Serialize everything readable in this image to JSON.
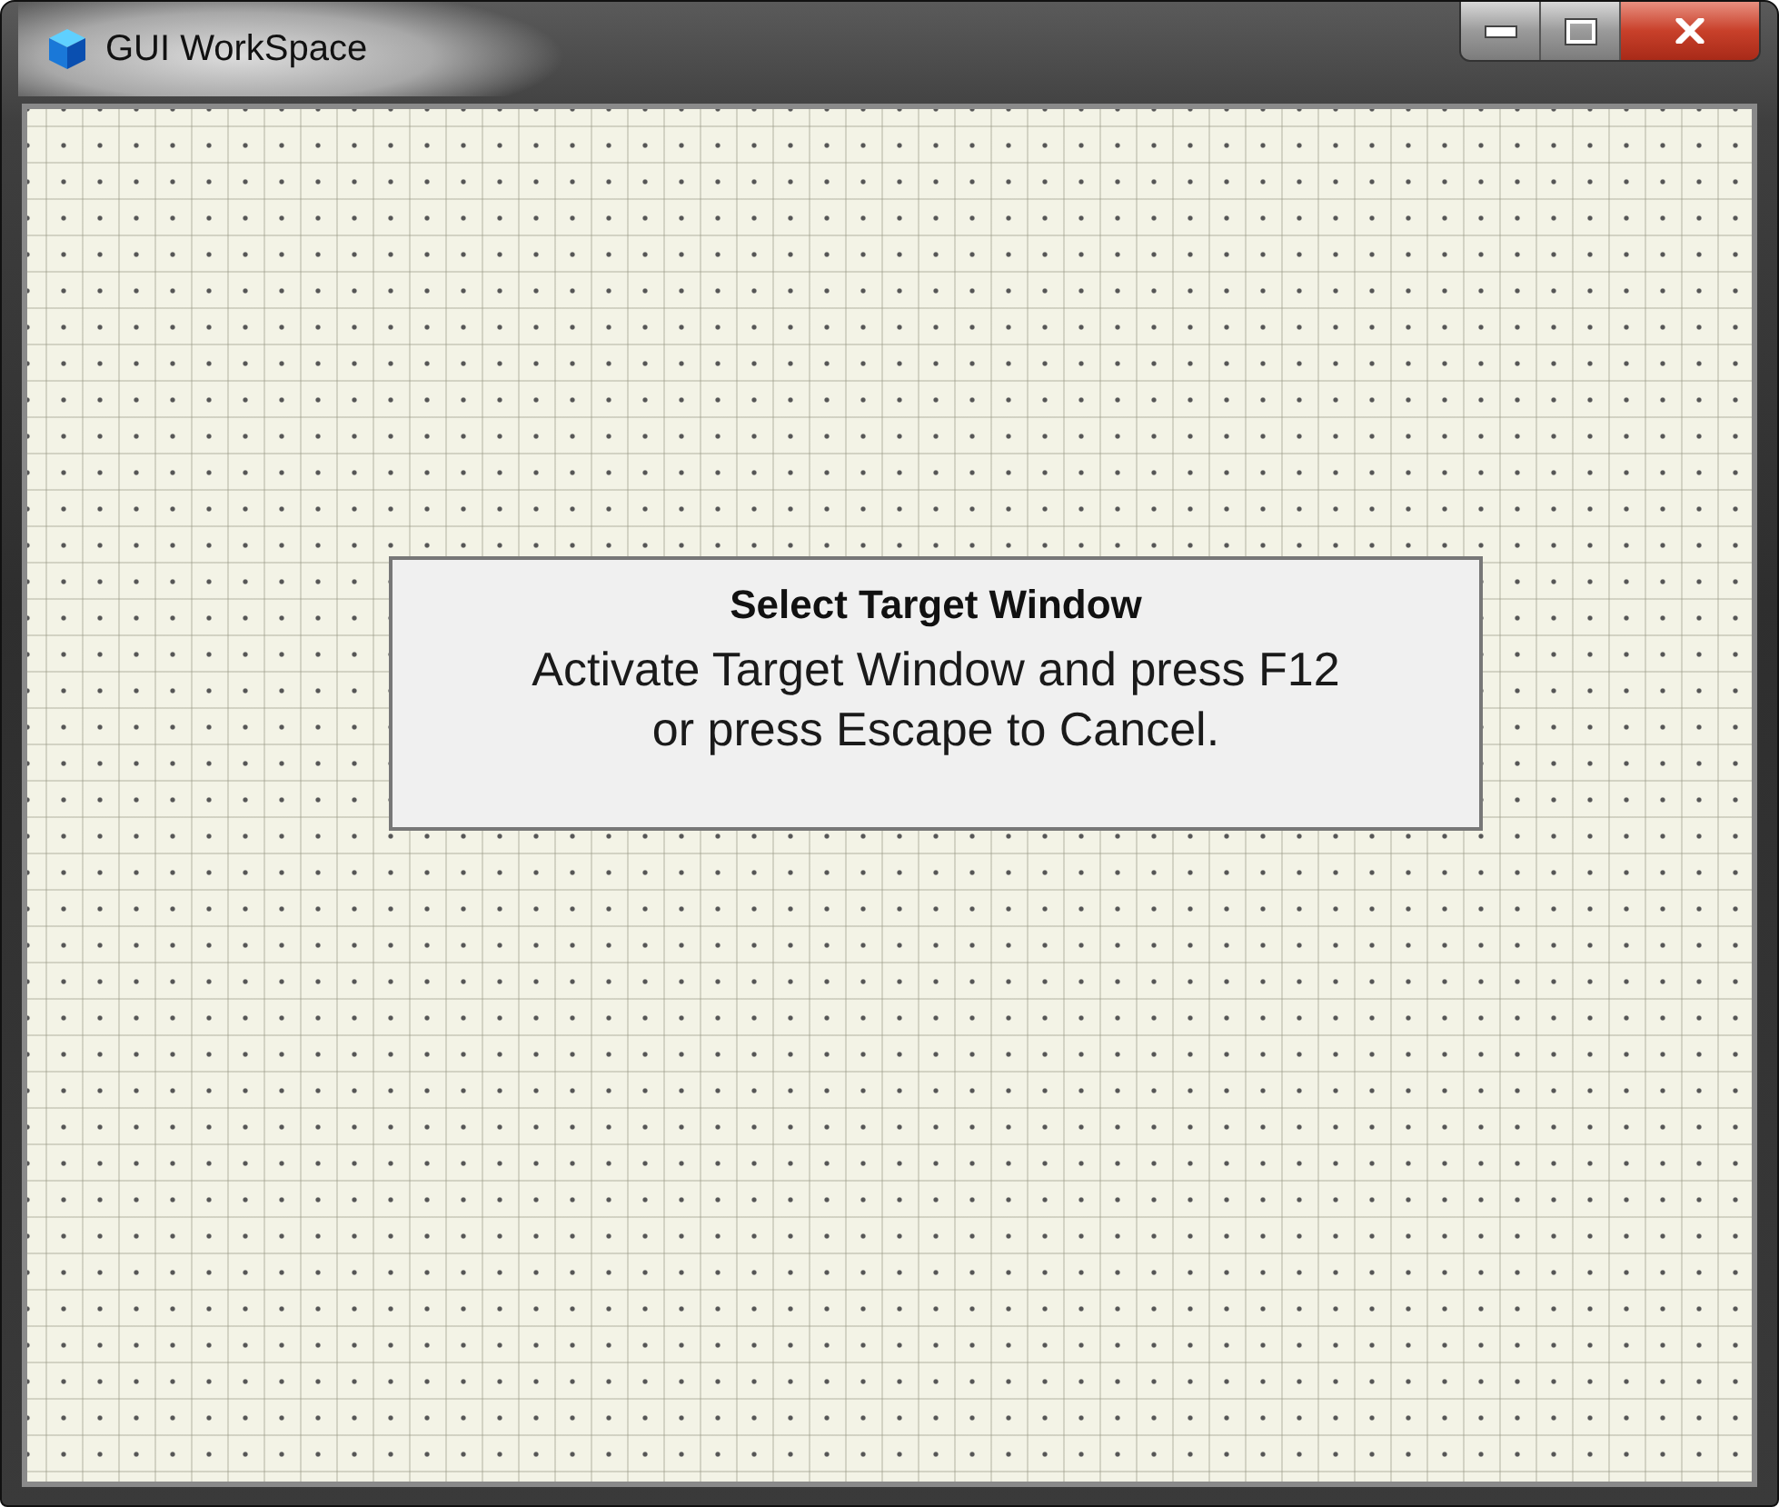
{
  "window": {
    "title": "GUI WorkSpace",
    "buttons": [
      {
        "kind": "minimize"
      },
      {
        "kind": "maximize"
      },
      {
        "kind": "close"
      }
    ]
  },
  "dialog": {
    "title": "Select Target Window",
    "message": "Activate Target Window and press F12\nor press Escape to Cancel."
  }
}
